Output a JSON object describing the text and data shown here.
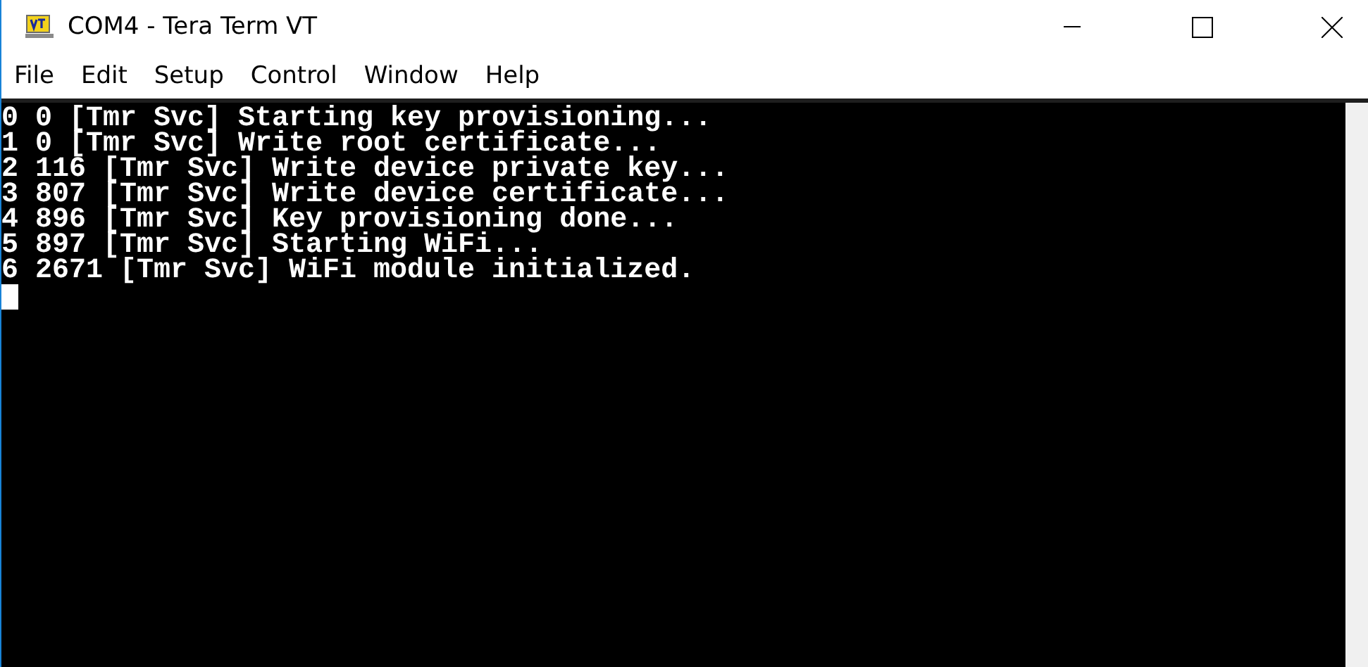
{
  "window": {
    "title": "COM4 - Tera Term VT"
  },
  "menu": [
    "File",
    "Edit",
    "Setup",
    "Control",
    "Window",
    "Help"
  ],
  "terminal": {
    "lines": [
      "0 0 [Tmr Svc] Starting key provisioning...",
      "1 0 [Tmr Svc] Write root certificate...",
      "2 116 [Tmr Svc] Write device private key...",
      "3 807 [Tmr Svc] Write device certificate...",
      "4 896 [Tmr Svc] Key provisioning done...",
      "5 897 [Tmr Svc] Starting WiFi...",
      "6 2671 [Tmr Svc] WiFi module initialized."
    ]
  }
}
